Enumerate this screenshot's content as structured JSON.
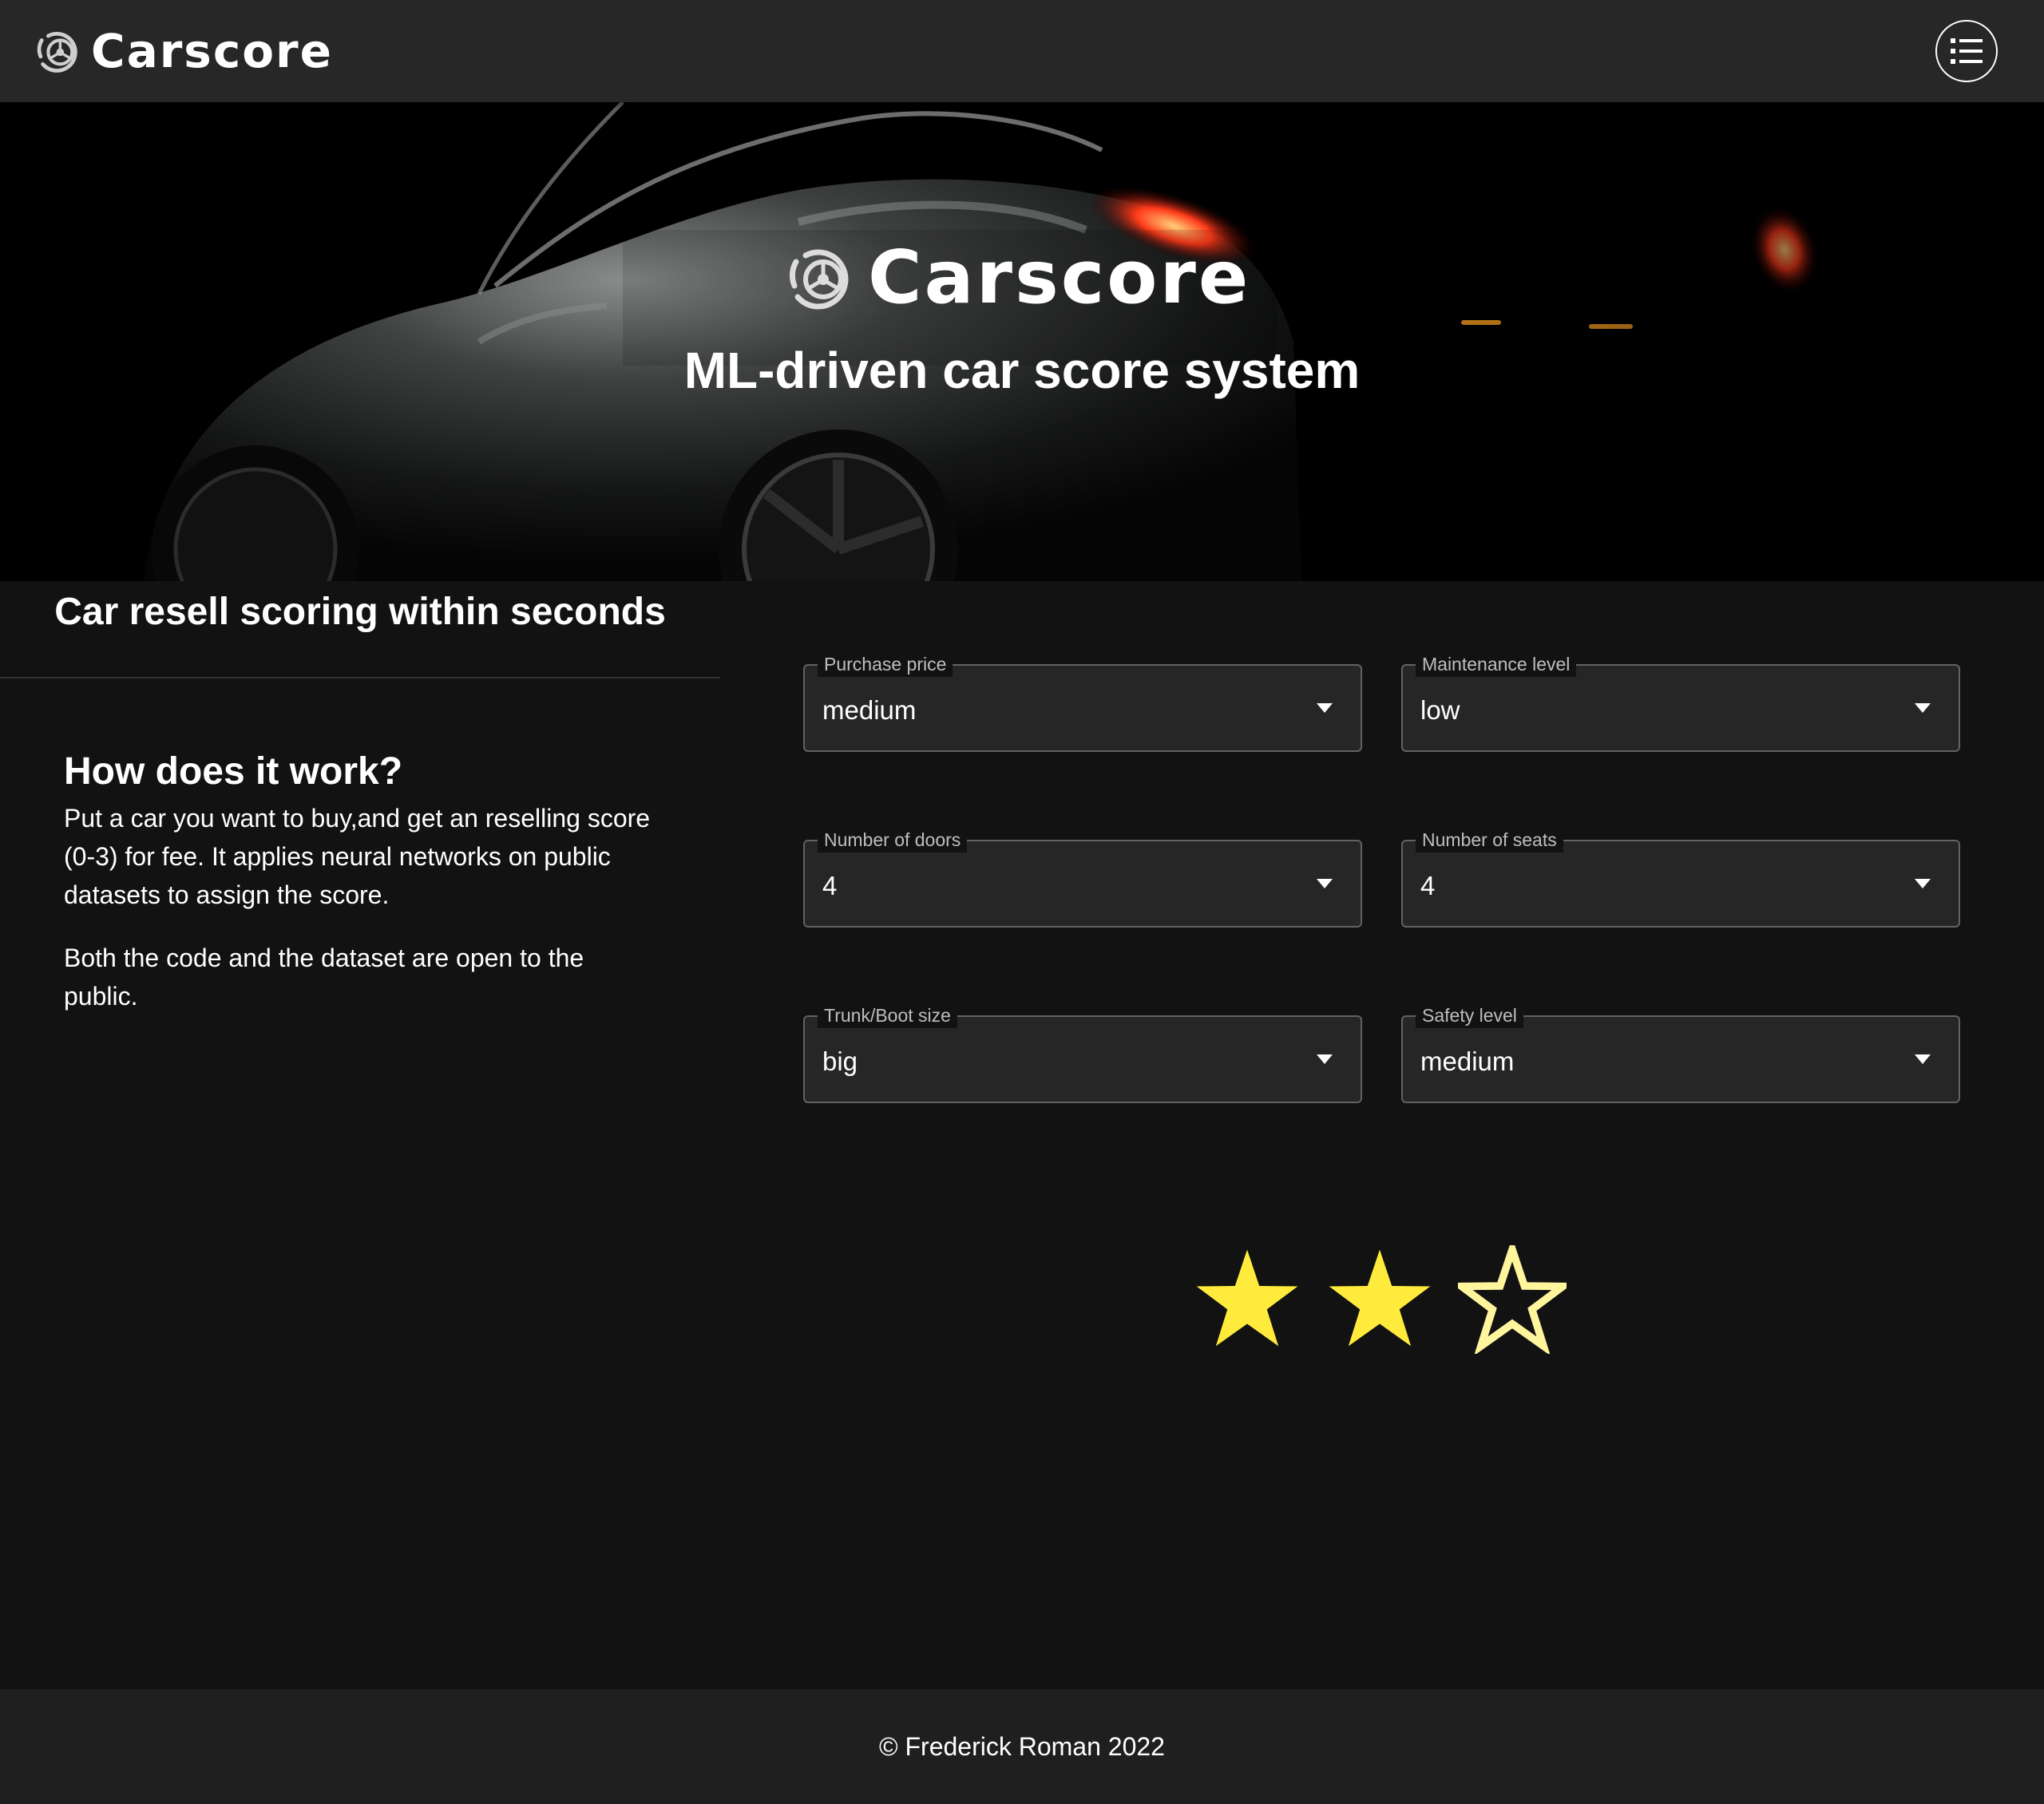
{
  "header": {
    "brand_name": "Carscore",
    "logo_icon": "tire-logo-icon",
    "menu_icon": "list-menu-icon"
  },
  "hero": {
    "brand_name": "Carscore",
    "tagline": "ML-driven car score system"
  },
  "sidebar": {
    "section_title": "Car resell scoring within seconds",
    "how_title": "How does it work?",
    "how_paragraph_1": "Put a car you want to buy,and get an reselling score (0-3) for fee. It applies neural networks on public datasets to assign the score.",
    "how_paragraph_2": "Both the code and the dataset are open to the public."
  },
  "form": {
    "fields": [
      {
        "label": "Purchase price",
        "value": "medium"
      },
      {
        "label": "Maintenance level",
        "value": "low"
      },
      {
        "label": "Number of doors",
        "value": "4"
      },
      {
        "label": "Number of seats",
        "value": "4"
      },
      {
        "label": "Trunk/Boot size",
        "value": "big"
      },
      {
        "label": "Safety level",
        "value": "medium"
      }
    ]
  },
  "rating": {
    "score": 2,
    "max": 3,
    "filled_color": "#ffeb3b",
    "outline_color": "#fff59d"
  },
  "footer": {
    "text": "© Frederick Roman 2022"
  }
}
